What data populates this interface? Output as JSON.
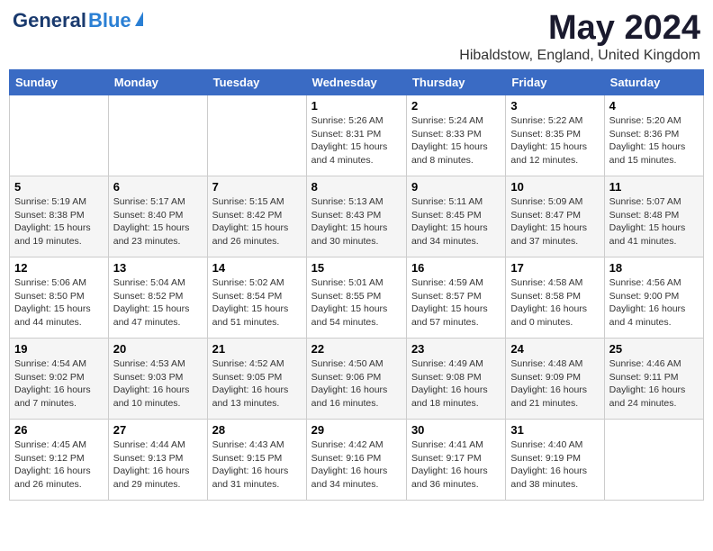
{
  "header": {
    "logo_general": "General",
    "logo_blue": "Blue",
    "month": "May 2024",
    "location": "Hibaldstow, England, United Kingdom"
  },
  "days_of_week": [
    "Sunday",
    "Monday",
    "Tuesday",
    "Wednesday",
    "Thursday",
    "Friday",
    "Saturday"
  ],
  "weeks": [
    [
      {
        "day": "",
        "info": ""
      },
      {
        "day": "",
        "info": ""
      },
      {
        "day": "",
        "info": ""
      },
      {
        "day": "1",
        "info": "Sunrise: 5:26 AM\nSunset: 8:31 PM\nDaylight: 15 hours and 4 minutes."
      },
      {
        "day": "2",
        "info": "Sunrise: 5:24 AM\nSunset: 8:33 PM\nDaylight: 15 hours and 8 minutes."
      },
      {
        "day": "3",
        "info": "Sunrise: 5:22 AM\nSunset: 8:35 PM\nDaylight: 15 hours and 12 minutes."
      },
      {
        "day": "4",
        "info": "Sunrise: 5:20 AM\nSunset: 8:36 PM\nDaylight: 15 hours and 15 minutes."
      }
    ],
    [
      {
        "day": "5",
        "info": "Sunrise: 5:19 AM\nSunset: 8:38 PM\nDaylight: 15 hours and 19 minutes."
      },
      {
        "day": "6",
        "info": "Sunrise: 5:17 AM\nSunset: 8:40 PM\nDaylight: 15 hours and 23 minutes."
      },
      {
        "day": "7",
        "info": "Sunrise: 5:15 AM\nSunset: 8:42 PM\nDaylight: 15 hours and 26 minutes."
      },
      {
        "day": "8",
        "info": "Sunrise: 5:13 AM\nSunset: 8:43 PM\nDaylight: 15 hours and 30 minutes."
      },
      {
        "day": "9",
        "info": "Sunrise: 5:11 AM\nSunset: 8:45 PM\nDaylight: 15 hours and 34 minutes."
      },
      {
        "day": "10",
        "info": "Sunrise: 5:09 AM\nSunset: 8:47 PM\nDaylight: 15 hours and 37 minutes."
      },
      {
        "day": "11",
        "info": "Sunrise: 5:07 AM\nSunset: 8:48 PM\nDaylight: 15 hours and 41 minutes."
      }
    ],
    [
      {
        "day": "12",
        "info": "Sunrise: 5:06 AM\nSunset: 8:50 PM\nDaylight: 15 hours and 44 minutes."
      },
      {
        "day": "13",
        "info": "Sunrise: 5:04 AM\nSunset: 8:52 PM\nDaylight: 15 hours and 47 minutes."
      },
      {
        "day": "14",
        "info": "Sunrise: 5:02 AM\nSunset: 8:54 PM\nDaylight: 15 hours and 51 minutes."
      },
      {
        "day": "15",
        "info": "Sunrise: 5:01 AM\nSunset: 8:55 PM\nDaylight: 15 hours and 54 minutes."
      },
      {
        "day": "16",
        "info": "Sunrise: 4:59 AM\nSunset: 8:57 PM\nDaylight: 15 hours and 57 minutes."
      },
      {
        "day": "17",
        "info": "Sunrise: 4:58 AM\nSunset: 8:58 PM\nDaylight: 16 hours and 0 minutes."
      },
      {
        "day": "18",
        "info": "Sunrise: 4:56 AM\nSunset: 9:00 PM\nDaylight: 16 hours and 4 minutes."
      }
    ],
    [
      {
        "day": "19",
        "info": "Sunrise: 4:54 AM\nSunset: 9:02 PM\nDaylight: 16 hours and 7 minutes."
      },
      {
        "day": "20",
        "info": "Sunrise: 4:53 AM\nSunset: 9:03 PM\nDaylight: 16 hours and 10 minutes."
      },
      {
        "day": "21",
        "info": "Sunrise: 4:52 AM\nSunset: 9:05 PM\nDaylight: 16 hours and 13 minutes."
      },
      {
        "day": "22",
        "info": "Sunrise: 4:50 AM\nSunset: 9:06 PM\nDaylight: 16 hours and 16 minutes."
      },
      {
        "day": "23",
        "info": "Sunrise: 4:49 AM\nSunset: 9:08 PM\nDaylight: 16 hours and 18 minutes."
      },
      {
        "day": "24",
        "info": "Sunrise: 4:48 AM\nSunset: 9:09 PM\nDaylight: 16 hours and 21 minutes."
      },
      {
        "day": "25",
        "info": "Sunrise: 4:46 AM\nSunset: 9:11 PM\nDaylight: 16 hours and 24 minutes."
      }
    ],
    [
      {
        "day": "26",
        "info": "Sunrise: 4:45 AM\nSunset: 9:12 PM\nDaylight: 16 hours and 26 minutes."
      },
      {
        "day": "27",
        "info": "Sunrise: 4:44 AM\nSunset: 9:13 PM\nDaylight: 16 hours and 29 minutes."
      },
      {
        "day": "28",
        "info": "Sunrise: 4:43 AM\nSunset: 9:15 PM\nDaylight: 16 hours and 31 minutes."
      },
      {
        "day": "29",
        "info": "Sunrise: 4:42 AM\nSunset: 9:16 PM\nDaylight: 16 hours and 34 minutes."
      },
      {
        "day": "30",
        "info": "Sunrise: 4:41 AM\nSunset: 9:17 PM\nDaylight: 16 hours and 36 minutes."
      },
      {
        "day": "31",
        "info": "Sunrise: 4:40 AM\nSunset: 9:19 PM\nDaylight: 16 hours and 38 minutes."
      },
      {
        "day": "",
        "info": ""
      }
    ]
  ]
}
